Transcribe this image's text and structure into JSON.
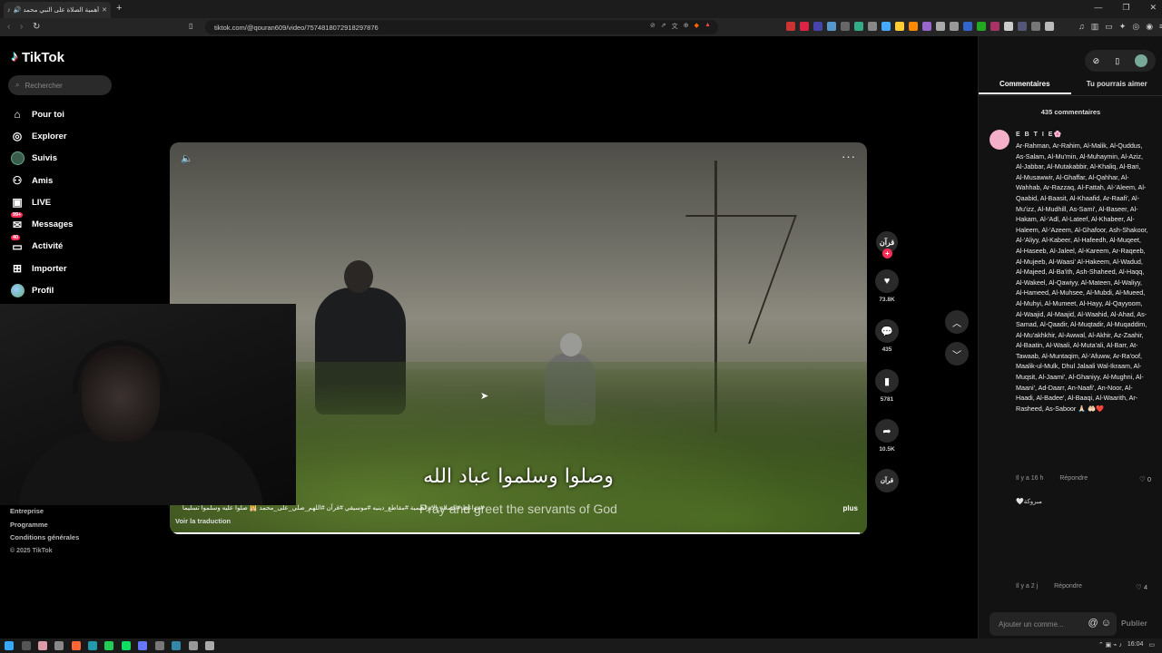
{
  "browser": {
    "tab_title": "أهمية الصلاة على النبي محمد",
    "new_tab_label": "+",
    "url": "tiktok.com/@qouran609/video/7574818072918297876"
  },
  "sidebar": {
    "logo": "TikTok",
    "search_placeholder": "Rechercher",
    "items": [
      {
        "label": "Pour toi",
        "icon": "home-icon"
      },
      {
        "label": "Explorer",
        "icon": "compass-icon"
      },
      {
        "label": "Suivis",
        "icon": "following-avatar"
      },
      {
        "label": "Amis",
        "icon": "friends-icon"
      },
      {
        "label": "LIVE",
        "icon": "live-icon"
      },
      {
        "label": "Messages",
        "icon": "message-icon",
        "badge": "99+"
      },
      {
        "label": "Activité",
        "icon": "activity-icon",
        "badge": "40"
      },
      {
        "label": "Importer",
        "icon": "upload-icon"
      },
      {
        "label": "Profil",
        "icon": "profile-avatar"
      }
    ],
    "footer": [
      "Entreprise",
      "Programme",
      "Conditions générales"
    ],
    "copyright": "© 2025 TikTok"
  },
  "video": {
    "subtitle_ar": "وصلوا وسلموا عباد الله",
    "subtitle_en": "Pray and greet the servants of God",
    "caption": "#مواعظ #الصلاة_الابراهيمية #مقاطع_دينيه #موسيقي #قرآن #اللهم_صلي_على_محمد 🕌 صلوا عليه وسلموا تسليما",
    "translate_label": "Voir la traduction",
    "more_label": "plus",
    "progress": 0.99
  },
  "actions": {
    "author_label": "قرآن",
    "likes": "73.8K",
    "comments": "435",
    "saves": "5781",
    "shares": "10.5K",
    "sound_label": "قرآن"
  },
  "comments_panel": {
    "tab_comments": "Commentaires",
    "tab_suggestions": "Tu pourrais aimer",
    "count_label": "435 commentaires",
    "first_comment": {
      "user": "E B T I E🌸",
      "text": "Ar-Rahman, Ar-Rahim, Al-Malik, Al-Quddus, As-Salam, Al-Mu'min, Al-Muhaymin, Al-Aziz, Al-Jabbar, Al-Mutakabbir, Al-Khaliq, Al-Bari, Al-Musawwir, Al-Ghaffar, Al-Qahhar, Al-Wahhab, Ar-Razzaq, Al-Fattah, Al-'Aleem, Al-Qaabid, Al-Baasit, Al-Khaafid, Ar-Raafi', Al-Mu'izz, Al-Mudhill, As-Sami', Al-Baseer, Al-Hakam, Al-'Adl, Al-Lateef, Al-Khabeer, Al-Haleem, Al-'Azeem, Al-Ghafoor, Ash-Shakoor, Al-'Aliyy, Al-Kabeer, Al-Hafeedh, Al-Muqeet, Al-Haseeb, Al-Jaleel, Al-Kareem, Ar-Raqeeb, Al-Mujeeb, Al-Waasi' Al-Hakeem, Al-Wadud, Al-Majeed, Al-Ba'ith, Ash-Shaheed, Al-Haqq, Al-Wakeel, Al-Qawiyy, Al-Mateen, Al-Waliyy, Al-Hameed, Al-Muhsee, Al-Mubdi, Al-Mueed, Al-Muhyi, Al-Mumeet, Al-Hayy, Al-Qayyoom, Al-Waajid, Al-Maajid, Al-Waahid, Al-Ahad, As-Samad, Al-Qaadir, Al-Muqtadir, Al-Muqaddim, Al-Mu'akhkhir, Al-Awwal, Al-Akhir, Az-Zaahir, Al-Baatin, Al-Waali, Al-Muta'ali, Al-Barr, At- Tawaab, Al-Muntaqim, Al-'Afuww, Ar-Ra'oof, Maalik-ul-Mulk, Dhul Jalaali Wal-Ikraam, Al-Muqsit, Al-Jaami', Al-Ghaniyy, Al-Mughni, Al-Maani', Ad-Daarr, An-Naafi', An-Noor, Al-Haadi, Al-Badee', Al-Baaqi, Al-Waarith, Ar-Rasheed, As-Saboor 🙏🏻 🤲🏻❤️",
      "time": "Il y a 16 h",
      "reply": "Répondre",
      "likes": "0"
    },
    "second_comment": {
      "text": "مبروكة🤍",
      "time": "Il y a 2 j",
      "reply": "Répondre",
      "likes": "4"
    },
    "add_placeholder": "Ajouter un comme...",
    "publish_label": "Publier"
  },
  "taskbar": {
    "time": "16:04"
  }
}
